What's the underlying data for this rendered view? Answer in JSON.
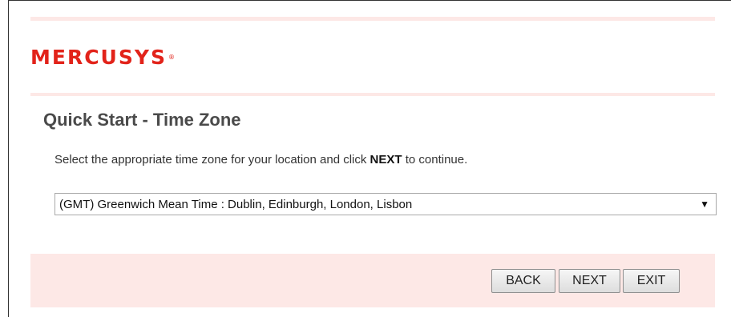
{
  "brand": {
    "logo_text": "MERCUSYS",
    "trademark": "®"
  },
  "page": {
    "title": "Quick Start - Time Zone",
    "instruction_before": "Select the appropriate time zone for your location and click ",
    "instruction_keyword": "NEXT",
    "instruction_after": " to continue."
  },
  "timezone_select": {
    "selected": "(GMT) Greenwich Mean Time : Dublin, Edinburgh, London, Lisbon",
    "arrow_glyph": "▼"
  },
  "buttons": {
    "back": "BACK",
    "next": "NEXT",
    "exit": "EXIT"
  },
  "colors": {
    "brand_red": "#e2231a",
    "accent_pink": "#fde8e6",
    "title_gray": "#4a4a4a"
  }
}
